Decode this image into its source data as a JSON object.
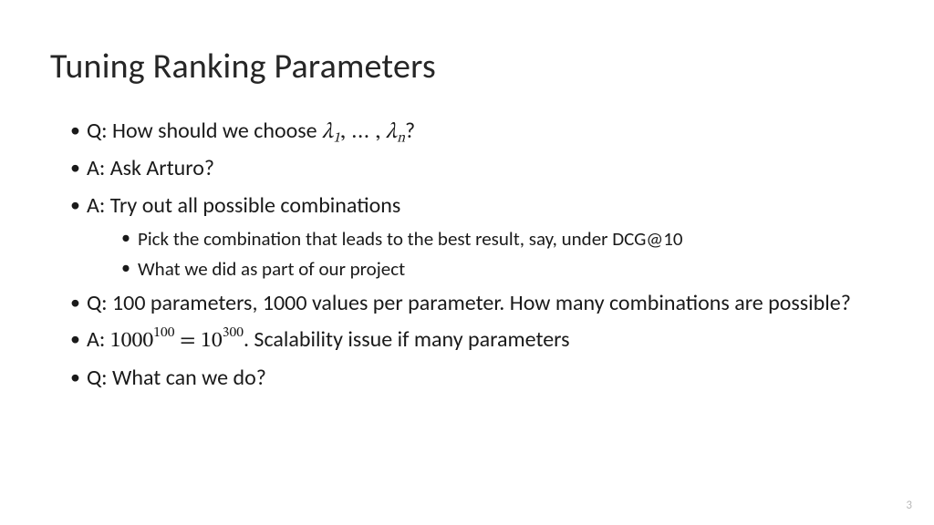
{
  "title": "Tuning Ranking Parameters",
  "bullets": {
    "b1_pre": "Q: How should we choose ",
    "b1_post": "?",
    "b2": "A: Ask Arturo?",
    "b3": "A: Try out all possible combinations",
    "b3_sub1": "Pick the combination that leads to the best result, say, under DCG@10",
    "b3_sub2": "What we did as part of our project",
    "b4": "Q: 100 parameters, 1000 values per parameter. How many combinations are possible?",
    "b5_pre": "A: ",
    "b5_post": ". Scalability issue if many parameters",
    "b6": "Q: What can we do?"
  },
  "math": {
    "lambda1_base": "λ",
    "lambda1_sub": "1",
    "sep": ", … , ",
    "lambdan_base": "λ",
    "lambdan_sub": "n",
    "m_base1": "1000",
    "m_exp1": "100",
    "m_eq": " = ",
    "m_base2": "10",
    "m_exp2": "300"
  },
  "page_number": "3"
}
